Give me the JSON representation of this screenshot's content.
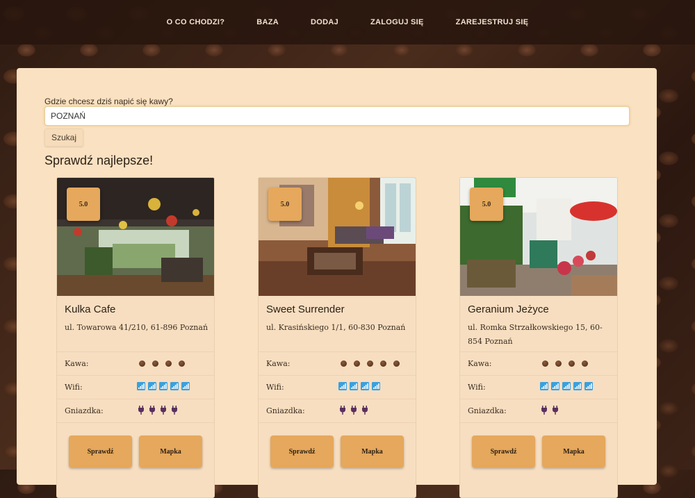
{
  "nav": {
    "items": [
      "O CO CHODZI?",
      "BAZA",
      "DODAJ",
      "ZALOGUJ SIĘ",
      "ZAREJESTRUJ SIĘ"
    ]
  },
  "search": {
    "label": "Gdzie chcesz dziś napić się kawy?",
    "value": "POZNAŃ",
    "button_label": "Szukaj"
  },
  "section": {
    "title": "Sprawdź najlepsze!"
  },
  "labels": {
    "coffee": "Kawa:",
    "wifi": "Wifi:",
    "sockets": "Gniazdka:",
    "check_button": "Sprawdź",
    "map_button": "Mapka"
  },
  "colors": {
    "accent": "#e5a85c",
    "panel": "#f9e1c1",
    "wifi_icon": "#3aa0de",
    "socket_icon": "#5a2f5e"
  },
  "cafes": [
    {
      "rating": "5.0",
      "name": "Kulka Cafe",
      "address": "ul. Towarowa 41/210, 61-896 Poznań",
      "coffee": 4,
      "wifi": 5,
      "sockets": 4
    },
    {
      "rating": "5.0",
      "name": "Sweet Surrender",
      "address": "ul. Krasińskiego 1/1, 60-830 Poznań",
      "coffee": 5,
      "wifi": 4,
      "sockets": 3
    },
    {
      "rating": "5.0",
      "name": "Geranium Jeżyce",
      "address": "ul. Romka Strzałkowskiego 15, 60-854 Poznań",
      "coffee": 4,
      "wifi": 5,
      "sockets": 2
    }
  ]
}
